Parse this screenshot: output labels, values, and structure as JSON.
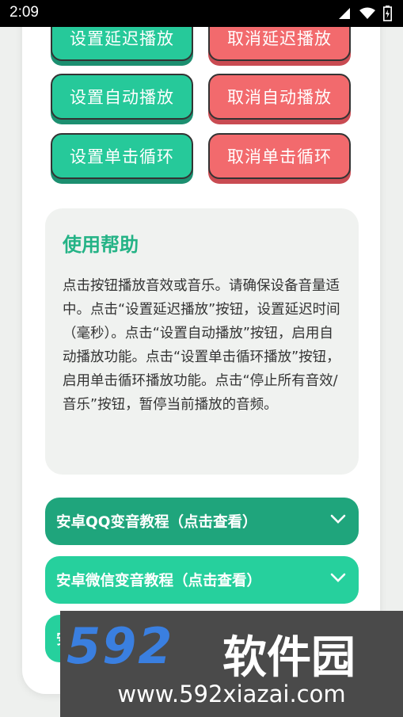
{
  "status_bar": {
    "time": "2:09"
  },
  "buttons": [
    {
      "left": "设置延迟播放",
      "right": "取消延迟播放"
    },
    {
      "left": "设置自动播放",
      "right": "取消自动播放"
    },
    {
      "left": "设置单击循环",
      "right": "取消单击循环"
    }
  ],
  "help": {
    "title": "使用帮助",
    "body": "点击按钮播放音效或音乐。请确保设备音量适中。点击“设置延迟播放”按钮，设置延迟时间（毫秒）。点击“设置自动播放”按钮，启用自动播放功能。点击“设置单击循环播放”按钮，启用单击循环播放功能。点击“停止所有音效/音乐”按钮，暂停当前播放的音频。"
  },
  "accordions": [
    {
      "label": "安卓QQ变音教程（点击查看）",
      "color": "#1fa57c"
    },
    {
      "label": "安卓微信变音教程（点击查看）",
      "color": "#26d09d"
    },
    {
      "label": "安",
      "color": "#26d09d"
    }
  ],
  "watermark": {
    "logo": "592",
    "name": "软件园",
    "url": "www.592xiazai.com"
  },
  "colors": {
    "accent_green": "#26c99a",
    "accent_red": "#f26a6d"
  }
}
